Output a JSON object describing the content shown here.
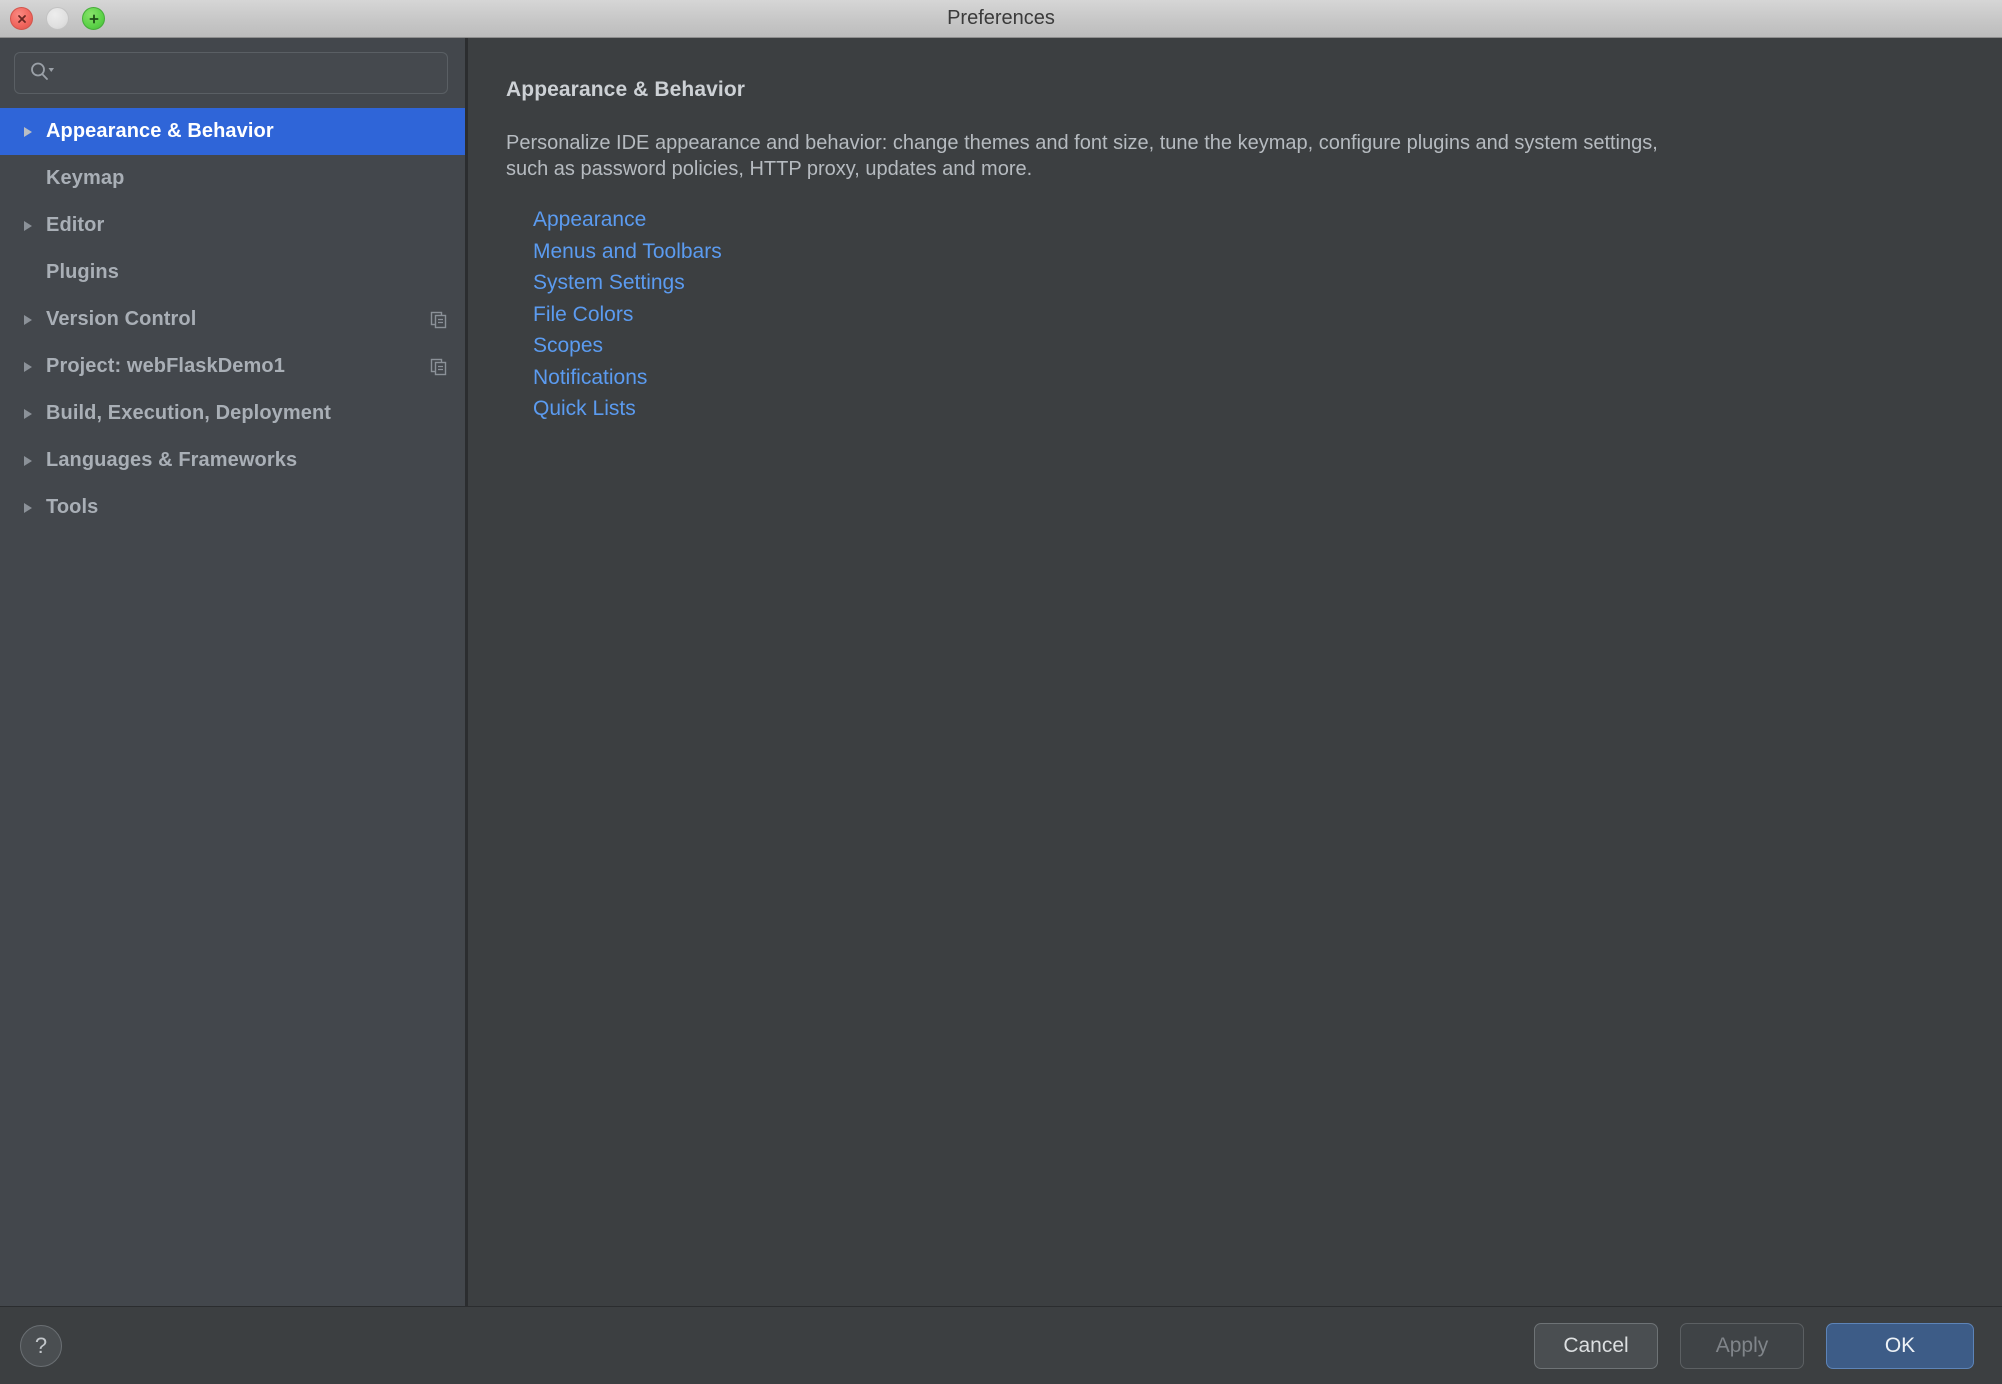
{
  "window": {
    "title": "Preferences",
    "traffic_lights": [
      {
        "name": "close",
        "color": "#f0645c",
        "enabled": true
      },
      {
        "name": "minimize",
        "color": "#e0e0e0",
        "enabled": false
      },
      {
        "name": "zoom",
        "color": "#5cd248",
        "enabled": true
      }
    ]
  },
  "sidebar": {
    "search": {
      "value": "",
      "placeholder": "",
      "icon": "search-icon"
    },
    "items": [
      {
        "label": "Appearance & Behavior",
        "expandable": true,
        "selected": true,
        "badge": null
      },
      {
        "label": "Keymap",
        "expandable": false,
        "selected": false,
        "badge": null
      },
      {
        "label": "Editor",
        "expandable": true,
        "selected": false,
        "badge": null
      },
      {
        "label": "Plugins",
        "expandable": false,
        "selected": false,
        "badge": null
      },
      {
        "label": "Version Control",
        "expandable": true,
        "selected": false,
        "badge": "copy-icon"
      },
      {
        "label": "Project: webFlaskDemo1",
        "expandable": true,
        "selected": false,
        "badge": "copy-icon"
      },
      {
        "label": "Build, Execution, Deployment",
        "expandable": true,
        "selected": false,
        "badge": null
      },
      {
        "label": "Languages & Frameworks",
        "expandable": true,
        "selected": false,
        "badge": null
      },
      {
        "label": "Tools",
        "expandable": true,
        "selected": false,
        "badge": null
      }
    ]
  },
  "content": {
    "title": "Appearance & Behavior",
    "description": "Personalize IDE appearance and behavior: change themes and font size, tune the keymap, configure plugins and system settings, such as password policies, HTTP proxy, updates and more.",
    "links": [
      {
        "label": "Appearance"
      },
      {
        "label": "Menus and Toolbars"
      },
      {
        "label": "System Settings"
      },
      {
        "label": "File Colors"
      },
      {
        "label": "Scopes"
      },
      {
        "label": "Notifications"
      },
      {
        "label": "Quick Lists"
      }
    ]
  },
  "footer": {
    "help_label": "?",
    "cancel_label": "Cancel",
    "apply_label": "Apply",
    "ok_label": "OK"
  },
  "colors": {
    "selection_blue": "#2f65d8",
    "link_blue": "#5b9bf0",
    "sidebar_bg": "#43474c",
    "content_bg": "#3c3f41",
    "ok_button_bg": "#3d5c87",
    "titlebar_bg": "#c8c8c8"
  }
}
